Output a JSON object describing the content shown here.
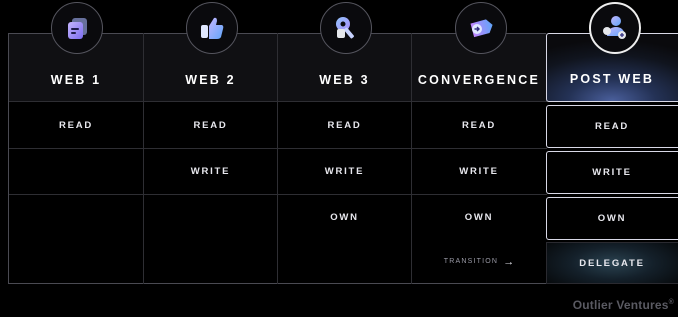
{
  "columns": [
    {
      "title": "WEB 1",
      "icon": "document-icon"
    },
    {
      "title": "WEB 2",
      "icon": "thumbs-up-icon"
    },
    {
      "title": "WEB 3",
      "icon": "key-icon"
    },
    {
      "title": "CONVERGENCE",
      "icon": "arrow-card-icon"
    },
    {
      "title": "POST WEB",
      "icon": "user-network-icon"
    }
  ],
  "cells": {
    "web1": {
      "read": "READ"
    },
    "web2": {
      "read": "READ",
      "write": "WRITE"
    },
    "web3": {
      "read": "READ",
      "write": "WRITE",
      "own": "OWN"
    },
    "convergence": {
      "read": "READ",
      "write": "WRITE",
      "own": "OWN",
      "transition": "TRANSITION"
    },
    "postweb": {
      "read": "READ",
      "write": "WRITE",
      "own": "OWN",
      "delegate": "DELEGATE"
    }
  },
  "brand": "Outlier Ventures",
  "brand_mark": "®",
  "colors": {
    "accent_gradient_start": "#a78bfa",
    "accent_gradient_end": "#60a5fa",
    "border": "#2e2e33",
    "highlight_border": "#d8d8e6"
  }
}
